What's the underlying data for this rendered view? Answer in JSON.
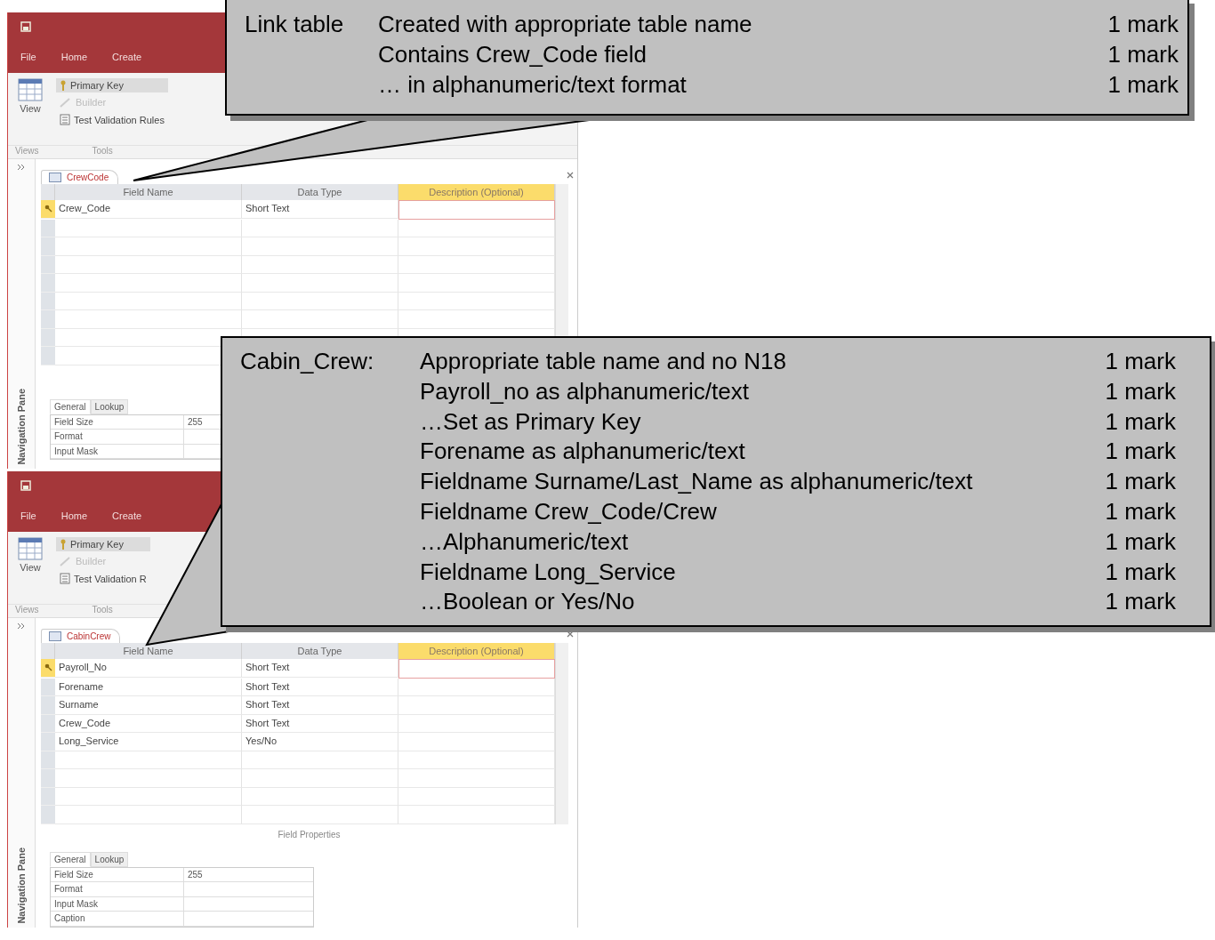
{
  "windows": [
    {
      "ribbon_tabs": [
        "File",
        "Home",
        "Create"
      ],
      "tools": [
        {
          "kind": "primary-key",
          "label": "Primary Key",
          "disabled": false
        },
        {
          "kind": "builder",
          "label": "Builder",
          "disabled": true
        },
        {
          "kind": "validation",
          "label": "Test Validation Rules",
          "disabled": false
        }
      ],
      "view_label": "View",
      "group_labels": [
        "Views",
        "Tools"
      ],
      "doc_tab": "CrewCode",
      "columns": [
        {
          "label": "Field Name",
          "selected": false
        },
        {
          "label": "Data Type",
          "selected": false
        },
        {
          "label": "Description (Optional)",
          "selected": true
        }
      ],
      "rows": [
        {
          "field_name": "Crew_Code",
          "data_type": "Short Text",
          "primary_key": true
        }
      ],
      "nav_pane": "Navigation Pane",
      "prop_tabs": [
        {
          "label": "General",
          "selected": true
        },
        {
          "label": "Lookup",
          "selected": false
        }
      ],
      "properties": [
        {
          "name": "Field Size",
          "value": "255"
        },
        {
          "name": "Format"
        },
        {
          "name": "Input Mask"
        }
      ]
    },
    {
      "ribbon_tabs": [
        "File",
        "Home",
        "Create"
      ],
      "tools": [
        {
          "kind": "primary-key",
          "label": "Primary Key",
          "disabled": false
        },
        {
          "kind": "builder",
          "label": "Builder",
          "disabled": true
        },
        {
          "kind": "validation",
          "label": "Test Validation R",
          "disabled": false
        }
      ],
      "view_label": "View",
      "group_labels": [
        "Views",
        "Tools"
      ],
      "doc_tab": "CabinCrew",
      "columns": [
        {
          "label": "Field Name",
          "selected": false
        },
        {
          "label": "Data Type",
          "selected": false
        },
        {
          "label": "Description (Optional)",
          "selected": true
        }
      ],
      "rows": [
        {
          "field_name": "Payroll_No",
          "data_type": "Short Text",
          "primary_key": true
        },
        {
          "field_name": "Forename",
          "data_type": "Short Text",
          "primary_key": false
        },
        {
          "field_name": "Surname",
          "data_type": "Short Text",
          "primary_key": false
        },
        {
          "field_name": "Crew_Code",
          "data_type": "Short Text",
          "primary_key": false
        },
        {
          "field_name": "Long_Service",
          "data_type": "Yes/No",
          "primary_key": false
        }
      ],
      "field_properties_label": "Field Properties",
      "nav_pane": "Navigation Pane",
      "prop_tabs": [
        {
          "label": "General",
          "selected": true
        },
        {
          "label": "Lookup",
          "selected": false
        }
      ],
      "properties": [
        {
          "name": "Field Size",
          "value": "255"
        },
        {
          "name": "Format"
        },
        {
          "name": "Input Mask"
        },
        {
          "name": "Caption"
        }
      ]
    }
  ],
  "callouts": [
    {
      "label": "Link table",
      "items": [
        {
          "criterion": "Created with appropriate table name",
          "mark": "1 mark"
        },
        {
          "criterion": "Contains Crew_Code field",
          "mark": "1 mark"
        },
        {
          "criterion": "… in alphanumeric/text format",
          "mark": "1 mark"
        }
      ]
    },
    {
      "label": "Cabin_Crew:",
      "items": [
        {
          "criterion": "Appropriate table name and no N18",
          "mark": "1 mark"
        },
        {
          "criterion": "Payroll_no as alphanumeric/text",
          "mark": "1 mark"
        },
        {
          "criterion": "…Set as Primary Key",
          "mark": "1 mark"
        },
        {
          "criterion": "Forename as alphanumeric/text",
          "mark": "1 mark"
        },
        {
          "criterion": "Fieldname Surname/Last_Name as alphanumeric/text",
          "mark": "1 mark"
        },
        {
          "criterion": "Fieldname Crew_Code/Crew",
          "mark": "1 mark"
        },
        {
          "criterion": "…Alphanumeric/text",
          "mark": "1 mark"
        },
        {
          "criterion": "Fieldname Long_Service",
          "mark": "1 mark"
        },
        {
          "criterion": "…Boolean or Yes/No",
          "mark": "1 mark"
        }
      ]
    }
  ]
}
